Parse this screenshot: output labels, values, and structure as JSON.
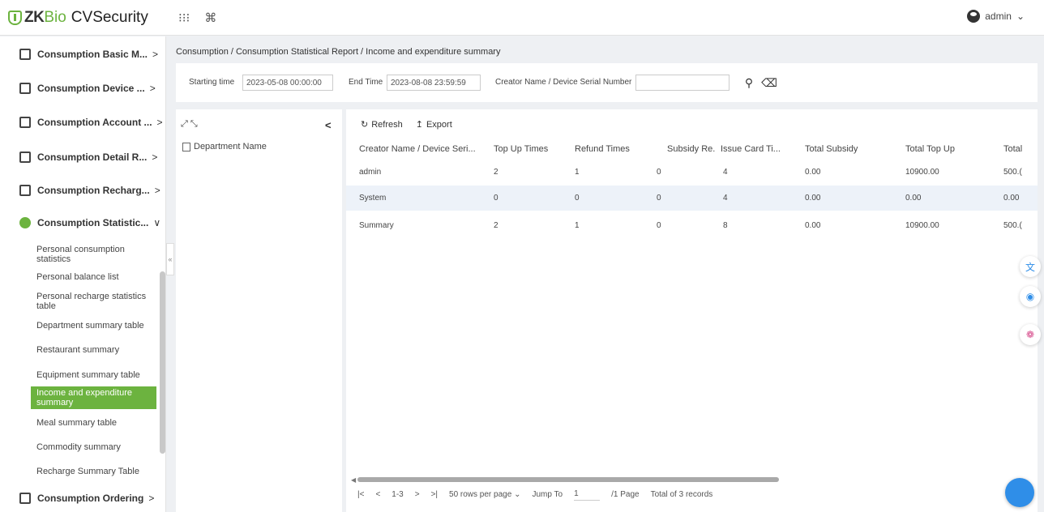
{
  "brand": {
    "prefix": "ZK",
    "bio": "Bio",
    "name": "CVSecurity"
  },
  "top_icons": [
    "grid-icon",
    "command-icon"
  ],
  "top_icon_glyphs": [
    "⁝⁝⁝",
    "⌘"
  ],
  "user": {
    "name": "admin",
    "chevron": "⌄"
  },
  "sidebar": {
    "menu": [
      {
        "label": "Consumption Basic M...",
        "chevron": ">"
      },
      {
        "label": "Consumption Device ...",
        "chevron": ">"
      },
      {
        "label": "Consumption Account ...",
        "chevron": ">"
      },
      {
        "label": "Consumption Detail R...",
        "chevron": ">"
      },
      {
        "label": "Consumption Recharg...",
        "chevron": ">"
      },
      {
        "label": "Consumption Statistic...",
        "chevron": "∨"
      }
    ],
    "submenu": [
      "Personal consumption statistics",
      "Personal balance list",
      "Personal recharge statistics table",
      "Department summary table",
      "Restaurant summary",
      "Equipment summary table",
      "Income and expenditure summary",
      "Meal summary table",
      "Commodity summary",
      "Recharge Summary Table"
    ],
    "active_index": 6,
    "bottom_menu": {
      "label": "Consumption Ordering",
      "chevron": ">"
    },
    "collapse_glyph": "«"
  },
  "breadcrumb": "Consumption / Consumption Statistical Report / Income and expenditure summary",
  "filters": {
    "start_label": "Starting time",
    "start_value": "2023-05-08 00:00:00",
    "end_label": "End Time",
    "end_value": "2023-08-08 23:59:59",
    "creator_label": "Creator Name / Device Serial Number",
    "creator_value": ""
  },
  "tree": {
    "expand_glyph": "⤢ ⤡",
    "collapse_glyph": "<",
    "root_label": "Department Name"
  },
  "toolbar": {
    "refresh": "Refresh",
    "export": "Export"
  },
  "table": {
    "columns": [
      "Creator Name / Device Seri...",
      "Top Up Times",
      "Refund Times",
      "Subsidy Re...",
      "Issue Card Ti...",
      "Total Subsidy",
      "Total Top Up",
      "Total"
    ],
    "rows": [
      [
        "admin",
        "2",
        "1",
        "0",
        "4",
        "0.00",
        "10900.00",
        "500.("
      ],
      [
        "System",
        "0",
        "0",
        "0",
        "4",
        "0.00",
        "0.00",
        "0.00"
      ],
      [
        "Summary",
        "2",
        "1",
        "0",
        "8",
        "0.00",
        "10900.00",
        "500.("
      ]
    ]
  },
  "pager": {
    "first": "|<",
    "prev": "<",
    "range": "1-3",
    "next": ">",
    "last": ">|",
    "rows_per_page": "50 rows per page",
    "jump_label": "Jump To",
    "jump_value": "1",
    "page_label": "/1 Page",
    "total": "Total of 3 records"
  },
  "colors": {
    "accent": "#6cb33f",
    "row_alt": "#edf2f9",
    "fab": "#2f8ee8"
  }
}
